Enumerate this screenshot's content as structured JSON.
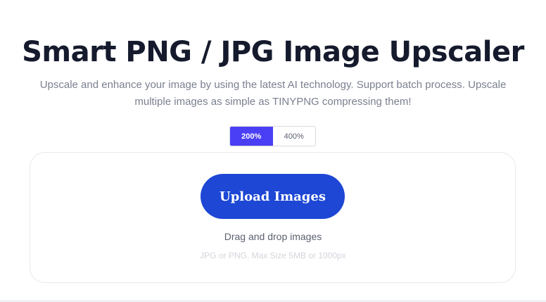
{
  "header": {
    "title": "Smart PNG / JPG Image Upscaler",
    "subtitle": "Upscale and enhance your image by using the latest AI technology. Support batch process. Upscale multiple images as simple as TINYPNG compressing them!"
  },
  "scale_toggle": {
    "options": [
      {
        "label": "200%",
        "selected": true
      },
      {
        "label": "400%",
        "selected": false
      }
    ]
  },
  "upload": {
    "button_label": "Upload Images",
    "drag_text": "Drag and drop images",
    "hint": "JPG or PNG. Max Size 5MB or 1000px"
  },
  "colors": {
    "accent": "#4b3ff5",
    "button": "#1d47d4",
    "title": "#151a2d"
  }
}
